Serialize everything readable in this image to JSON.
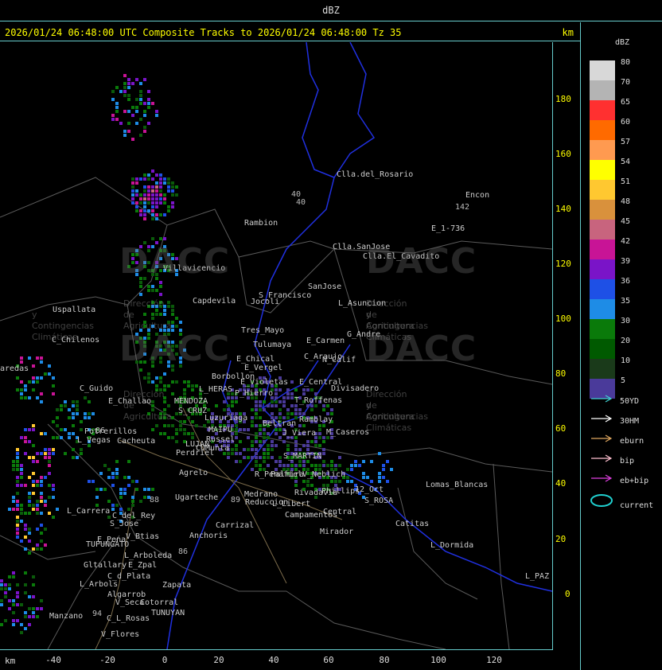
{
  "window": {
    "title": "dBZ"
  },
  "header": {
    "text": "2026/01/24 06:48:00 UTC Composite Tracks to 2026/01/24 06:48:00 Tz 35",
    "unit": "km"
  },
  "axes": {
    "x_unit": "km",
    "x_ticks": [
      "-40",
      "-20",
      "0",
      "20",
      "40",
      "60",
      "80",
      "100",
      "120"
    ],
    "y_ticks": [
      "180",
      "160",
      "140",
      "120",
      "100",
      "80",
      "60",
      "40",
      "20",
      "0"
    ]
  },
  "legend": {
    "title": "dBZ",
    "levels": [
      {
        "label": "80",
        "color": "#d8d8d8"
      },
      {
        "label": "70",
        "color": "#b4b4b4"
      },
      {
        "label": "65",
        "color": "#ff3030"
      },
      {
        "label": "60",
        "color": "#ff6a00"
      },
      {
        "label": "57",
        "color": "#ff9a50"
      },
      {
        "label": "54",
        "color": "#ffff00"
      },
      {
        "label": "51",
        "color": "#ffc830"
      },
      {
        "label": "48",
        "color": "#d9913c"
      },
      {
        "label": "45",
        "color": "#c8647e"
      },
      {
        "label": "42",
        "color": "#c81496"
      },
      {
        "label": "39",
        "color": "#7a14c8"
      },
      {
        "label": "36",
        "color": "#1e50e6"
      },
      {
        "label": "35",
        "color": "#1e8ce6"
      },
      {
        "label": "30",
        "color": "#0a7a0a"
      },
      {
        "label": "20",
        "color": "#005a00"
      },
      {
        "label": "10",
        "color": "#1a3a1a"
      },
      {
        "label": "5",
        "color": "#4a3a9a"
      }
    ]
  },
  "tracks": [
    {
      "label": "50YD",
      "color": "#40d0d0"
    },
    {
      "label": "30HM",
      "color": "#ffffff"
    },
    {
      "label": "eburn",
      "color": "#e0a860"
    },
    {
      "label": "bip",
      "color": "#ffc0d0"
    },
    {
      "label": "eb+bip",
      "color": "#e040e0"
    },
    {
      "label": "current",
      "color": "#20d0d0"
    }
  ],
  "watermark": {
    "brand": "DACC",
    "line1": "Dirección de Agricultura",
    "line2": "y Contingencias Climáticas"
  },
  "places": [
    {
      "name": "Clla.del_Rosario"
    },
    {
      "name": "Encon"
    },
    {
      "name": "Rambion"
    },
    {
      "name": "E_1-736"
    },
    {
      "name": "Clla.SanJose"
    },
    {
      "name": "Clla.El_Cavadito"
    },
    {
      "name": "Villavicencio"
    },
    {
      "name": "S_Francisco"
    },
    {
      "name": "SanJose"
    },
    {
      "name": "Capdevila"
    },
    {
      "name": "Jocoli"
    },
    {
      "name": "L_Asuncion"
    },
    {
      "name": "Uspallata"
    },
    {
      "name": "Tres_Mayo"
    },
    {
      "name": "G_Andre"
    },
    {
      "name": "E_Carmen"
    },
    {
      "name": "C_Chilenos"
    },
    {
      "name": "Tulumaya"
    },
    {
      "name": "C_Araujo"
    },
    {
      "name": "E_Chical"
    },
    {
      "name": "E_Vergel"
    },
    {
      "name": "N_Calif"
    },
    {
      "name": "Borbollon"
    },
    {
      "name": "E_Violetas"
    },
    {
      "name": "E_Central"
    },
    {
      "name": "Divisadero"
    },
    {
      "name": "aredas"
    },
    {
      "name": "C_Guido"
    },
    {
      "name": "L_HERAS"
    },
    {
      "name": "P_Hierro"
    },
    {
      "name": "E_Challao"
    },
    {
      "name": "MENDOZA"
    },
    {
      "name": "T_Roffenas"
    },
    {
      "name": "S_CRUZ"
    },
    {
      "name": "Luzuriaga"
    },
    {
      "name": "Beltran"
    },
    {
      "name": "Ramblay"
    },
    {
      "name": "Potrerillos"
    },
    {
      "name": "MAIPU"
    },
    {
      "name": "J_Viera"
    },
    {
      "name": "M_Caseros"
    },
    {
      "name": "L_Vegas"
    },
    {
      "name": "Cacheuta"
    },
    {
      "name": "Russel"
    },
    {
      "name": "LUJAN"
    },
    {
      "name": "CUMunta"
    },
    {
      "name": "S_MARTIN"
    },
    {
      "name": "Perdriel"
    },
    {
      "name": "Agrelo"
    },
    {
      "name": "R_Penafiel"
    },
    {
      "name": "Palmira"
    },
    {
      "name": "V_Neblich"
    },
    {
      "name": "Lomas_Blancas"
    },
    {
      "name": "Ugarteche"
    },
    {
      "name": "Medrano"
    },
    {
      "name": "Rivadavia"
    },
    {
      "name": "Phillips"
    },
    {
      "name": "12_Oct"
    },
    {
      "name": "Reduccion"
    },
    {
      "name": "L_Libert"
    },
    {
      "name": "S_ROSA"
    },
    {
      "name": "L_Carrera"
    },
    {
      "name": "C_del_Rey"
    },
    {
      "name": "S_Jose"
    },
    {
      "name": "Carrizal"
    },
    {
      "name": "Campamentos"
    },
    {
      "name": "Central"
    },
    {
      "name": "Catitas"
    },
    {
      "name": "V_Btias"
    },
    {
      "name": "Anchoris"
    },
    {
      "name": "E_Pena"
    },
    {
      "name": "TUPUNGATO"
    },
    {
      "name": "Mirador"
    },
    {
      "name": "L_Dormida"
    },
    {
      "name": "L_Arboleda"
    },
    {
      "name": "Gltallary"
    },
    {
      "name": "E_Zpal"
    },
    {
      "name": "C_d_Plata"
    },
    {
      "name": "L_Arbols"
    },
    {
      "name": "Zapata"
    },
    {
      "name": "L_PAZ"
    },
    {
      "name": "Algarrob"
    },
    {
      "name": "V_Seca"
    },
    {
      "name": "Cotorral"
    },
    {
      "name": "TUNUYAN"
    },
    {
      "name": "Manzano"
    },
    {
      "name": "C_L_Rosas"
    },
    {
      "name": "V_Flores"
    }
  ],
  "roads": [
    "40",
    "142",
    "40",
    "86",
    "88",
    "89",
    "86",
    "94"
  ]
}
